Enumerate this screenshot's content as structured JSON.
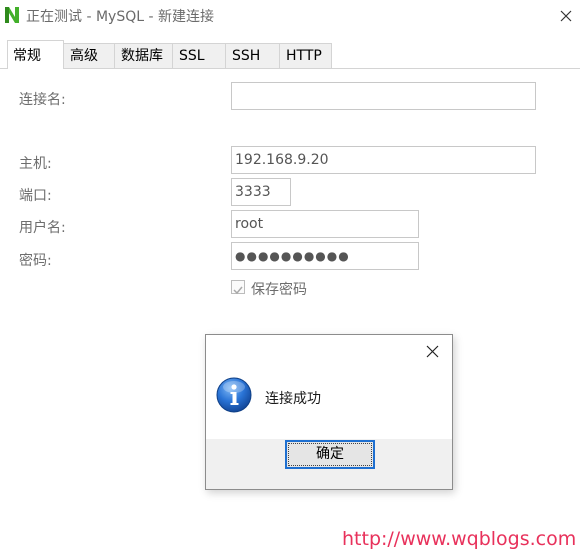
{
  "window": {
    "title": "正在测试 - MySQL - 新建连接"
  },
  "tabs": [
    {
      "label": "常规",
      "active": true
    },
    {
      "label": "高级",
      "active": false
    },
    {
      "label": "数据库",
      "active": false
    },
    {
      "label": "SSL",
      "active": false
    },
    {
      "label": "SSH",
      "active": false
    },
    {
      "label": "HTTP",
      "active": false
    }
  ],
  "form": {
    "connection_name": {
      "label": "连接名:",
      "value": ""
    },
    "host": {
      "label": "主机:",
      "value": "192.168.9.20"
    },
    "port": {
      "label": "端口:",
      "value": "3333"
    },
    "username": {
      "label": "用户名:",
      "value": "root"
    },
    "password": {
      "label": "密码:",
      "value": "●●●●●●●●●●"
    },
    "save_password": {
      "label": "保存密码",
      "checked": true
    }
  },
  "dialog": {
    "message": "连接成功",
    "ok_label": "确定",
    "icon": "info-icon"
  },
  "watermark": "http://www.wqblogs.com",
  "colors": {
    "accent": "#1e6fd0",
    "app_icon": "#43b02a",
    "watermark": "#e8315b"
  }
}
